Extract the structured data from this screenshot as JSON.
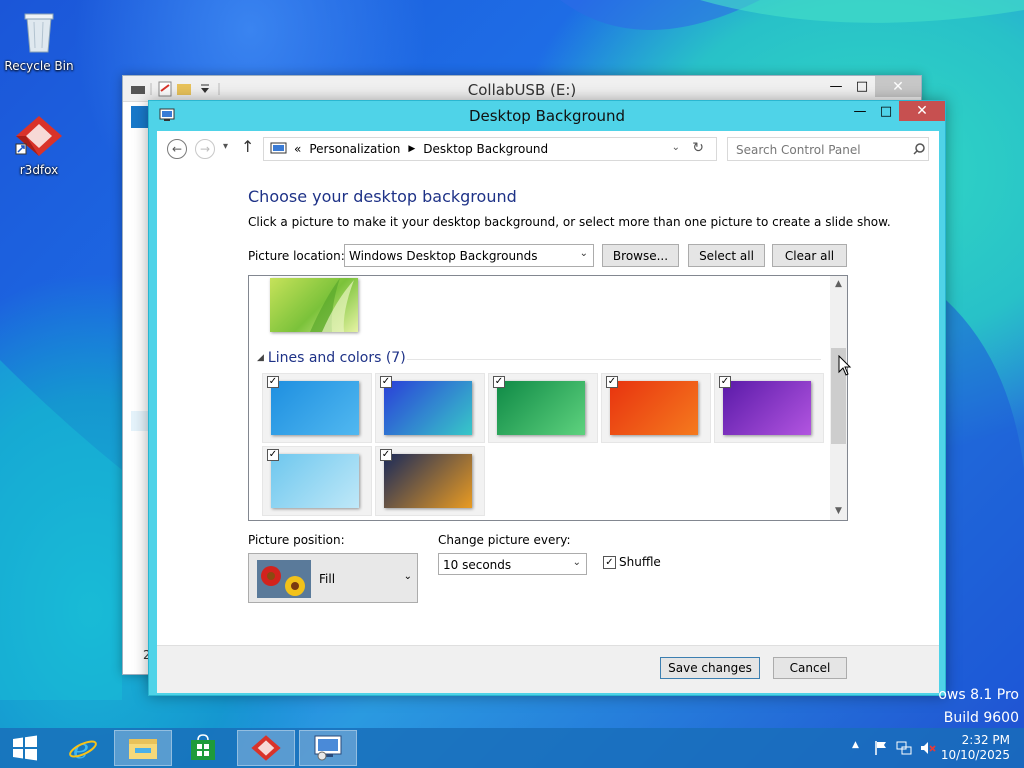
{
  "desktop": {
    "icons": [
      {
        "label": "Recycle Bin"
      },
      {
        "label": "r3dfox"
      }
    ],
    "watermark": {
      "line1": "ows 8.1 Pro",
      "line2": "Build 9600"
    }
  },
  "bg_window": {
    "title": "CollabUSB (E:)",
    "status_char": "2"
  },
  "window": {
    "title": "Desktop Background",
    "breadcrumb": {
      "prefix": "«",
      "items": [
        "Personalization",
        "Desktop Background"
      ]
    },
    "search_placeholder": "Search Control Panel",
    "heading": "Choose your desktop background",
    "description": "Click a picture to make it your desktop background, or select more than one picture to create a slide show.",
    "picture_location": {
      "label": "Picture location:",
      "value": "Windows Desktop Backgrounds"
    },
    "buttons": {
      "browse": "Browse...",
      "select_all": "Select all",
      "clear_all": "Clear all",
      "save": "Save changes",
      "cancel": "Cancel"
    },
    "gallery": {
      "group_title": "Lines and colors (7)",
      "items": [
        {
          "checked": true,
          "colors": [
            "#1e8fe0",
            "#51b8f0"
          ]
        },
        {
          "checked": true,
          "colors": [
            "#2a3fd8",
            "#38c8c8"
          ]
        },
        {
          "checked": true,
          "colors": [
            "#0f8a46",
            "#5ed27e"
          ]
        },
        {
          "checked": true,
          "colors": [
            "#e8330f",
            "#f57a1e"
          ]
        },
        {
          "checked": true,
          "colors": [
            "#5a1aa8",
            "#b255e0"
          ]
        },
        {
          "checked": true,
          "colors": [
            "#6ec7ee",
            "#bfe8f8"
          ]
        },
        {
          "checked": true,
          "colors": [
            "#1a2a5a",
            "#e99b22"
          ]
        }
      ]
    },
    "picture_position": {
      "label": "Picture position:",
      "value": "Fill"
    },
    "change_picture": {
      "label": "Change picture every:",
      "value": "10 seconds"
    },
    "shuffle": {
      "label": "Shuffle",
      "checked": true
    }
  },
  "taskbar": {
    "clock": {
      "time": "2:32 PM",
      "date": "10/10/2025"
    }
  }
}
